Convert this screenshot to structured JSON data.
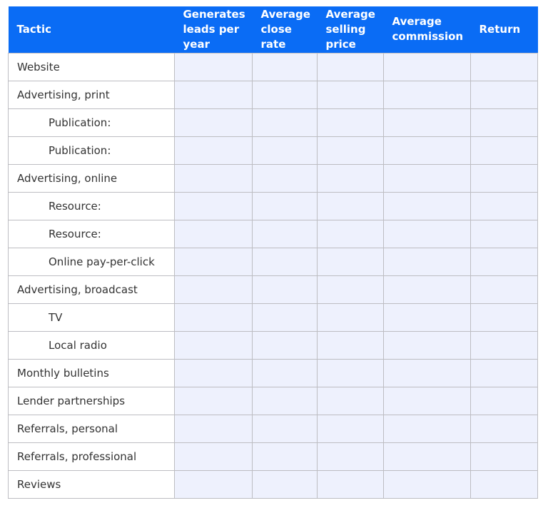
{
  "table": {
    "headers": [
      "Tactic",
      "Generates leads per year",
      "Average close rate",
      "Average selling price",
      "Average commission",
      "Return"
    ],
    "rows": [
      {
        "label": "Website",
        "indent": false
      },
      {
        "label": "Advertising, print",
        "indent": false
      },
      {
        "label": "Publication:",
        "indent": true
      },
      {
        "label": "Publication:",
        "indent": true
      },
      {
        "label": "Advertising, online",
        "indent": false
      },
      {
        "label": "Resource:",
        "indent": true
      },
      {
        "label": "Resource:",
        "indent": true
      },
      {
        "label": "Online pay-per-click",
        "indent": true
      },
      {
        "label": "Advertising, broadcast",
        "indent": false
      },
      {
        "label": "TV",
        "indent": true
      },
      {
        "label": "Local radio",
        "indent": true
      },
      {
        "label": "Monthly bulletins",
        "indent": false
      },
      {
        "label": "Lender partnerships",
        "indent": false
      },
      {
        "label": "Referrals, personal",
        "indent": false
      },
      {
        "label": "Referrals, professional",
        "indent": false
      },
      {
        "label": "Reviews",
        "indent": false
      }
    ]
  },
  "colors": {
    "header_bg": "#0a6cf5",
    "input_cell_bg": "#eef1fd",
    "border": "#bdbdc2"
  }
}
